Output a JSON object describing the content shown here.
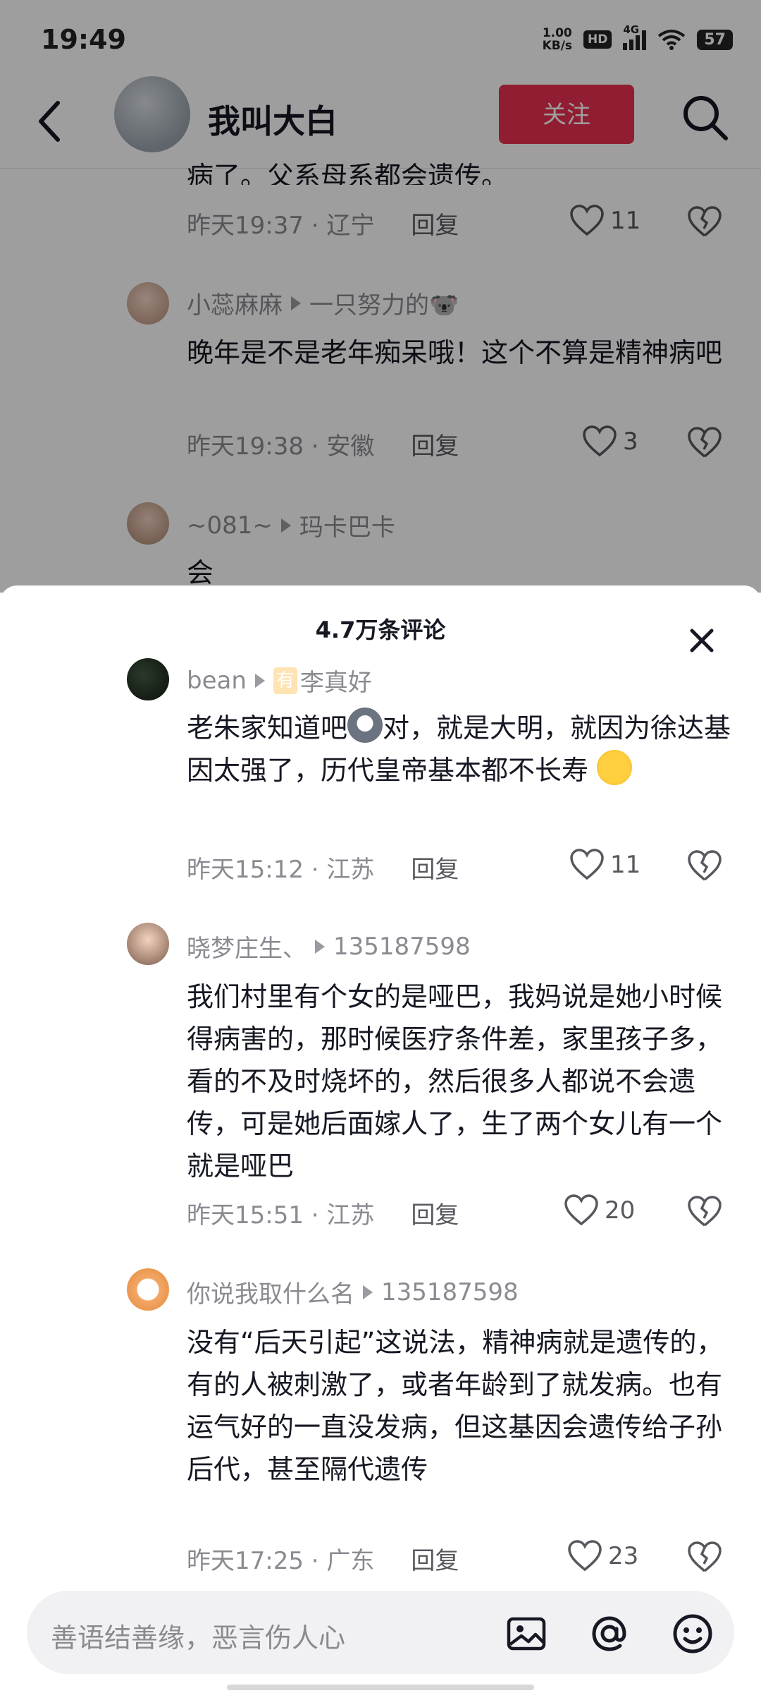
{
  "status": {
    "time": "19:49",
    "speed_value": "1.00",
    "speed_unit": "KB/s",
    "hd": "HD",
    "network": "4G",
    "battery": "57"
  },
  "header": {
    "username": "我叫大白",
    "follow_label": "关注"
  },
  "background_comments": [
    {
      "text": "病了。父系母系都会遗传。",
      "time": "昨天19:37",
      "location": "辽宁",
      "reply": "回复",
      "likes": "11"
    },
    {
      "user": "小蕊麻麻",
      "reply_to": "一只努力的🐨",
      "text": "晚年是不是老年痴呆哦！这个不算是精神病吧",
      "time": "昨天19:38",
      "location": "安徽",
      "reply": "回复",
      "likes": "3"
    },
    {
      "user": "~081~",
      "reply_to": "玛卡巴卡",
      "text": "会"
    }
  ],
  "sheet": {
    "title": "4.7万条评论",
    "comments": [
      {
        "user": "bean",
        "badge": "有",
        "reply_to": "李真好",
        "text_a": "老朱家知道吧",
        "text_b": "对，就是大明，就因为徐达基因太强了，历代皇帝基本都不长寿",
        "time": "昨天15:12",
        "location": "江苏",
        "reply": "回复",
        "likes": "11"
      },
      {
        "user": "晓梦庄生、",
        "reply_to": "135187598",
        "text": "我们村里有个女的是哑巴，我妈说是她小时候得病害的，那时候医疗条件差，家里孩子多，看的不及时烧坏的，然后很多人都说不会遗传，可是她后面嫁人了，生了两个女儿有一个就是哑巴",
        "time": "昨天15:51",
        "location": "江苏",
        "reply": "回复",
        "likes": "20"
      },
      {
        "user": "你说我取什么名",
        "reply_to": "135187598",
        "text": "没有“后天引起”这说法，精神病就是遗传的，有的人被刺激了，或者年龄到了就发病。也有运气好的一直没发病，但这基因会遗传给子孙后代，甚至隔代遗传",
        "time": "昨天17:25",
        "location": "广东",
        "reply": "回复",
        "likes": "23"
      }
    ]
  },
  "input": {
    "placeholder": "善语结善缘，恶言伤人心"
  },
  "colors": {
    "accent": "#e8304f",
    "meta": "#8a8b91"
  }
}
